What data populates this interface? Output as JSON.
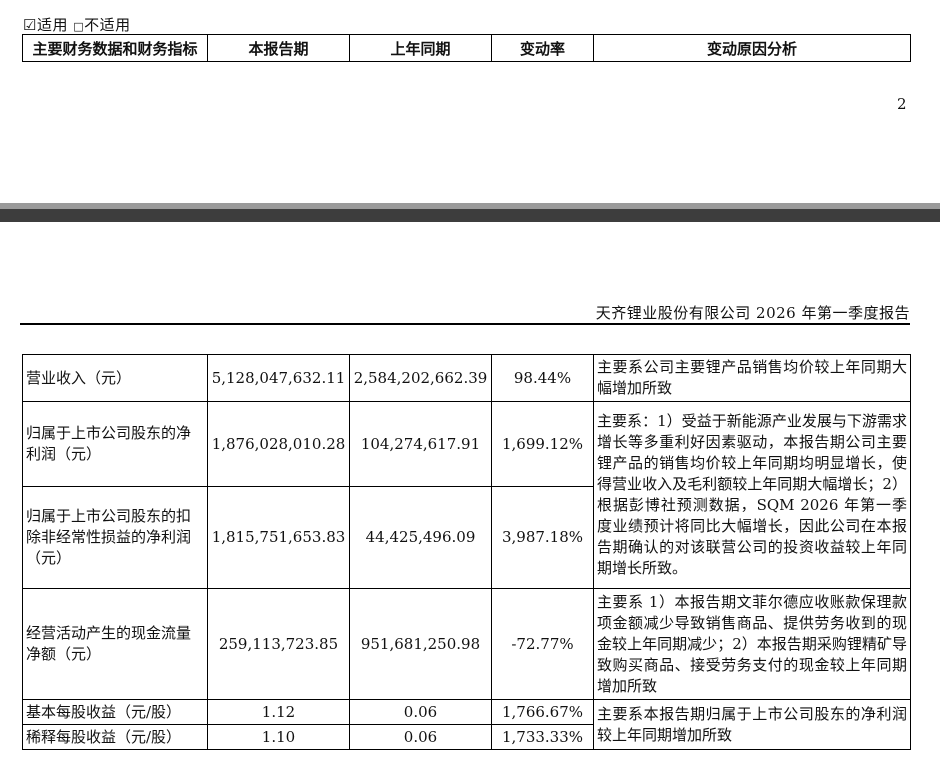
{
  "applicability": {
    "applicable_mark": "☑",
    "applicable_label": "适用",
    "not_applicable_mark": "□",
    "not_applicable_label": "不适用"
  },
  "header": {
    "col_indicator": "主要财务数据和财务指标",
    "col_current": "本报告期",
    "col_prior": "上年同期",
    "col_change": "变动率",
    "col_reason": "变动原因分析"
  },
  "page_number": "2",
  "report_title": "天齐锂业股份有限公司 2026 年第一季度报告",
  "rows": [
    {
      "label": "营业收入（元）",
      "current": "5,128,047,632.11",
      "prior": "2,584,202,662.39",
      "change": "98.44%",
      "reason": "主要系公司主要锂产品销售均价较上年同期大幅增加所致"
    },
    {
      "label": "归属于上市公司股东的净利润（元）",
      "current": "1,876,028,010.28",
      "prior": "104,274,617.91",
      "change": "1,699.12%",
      "reason": "主要系：1）受益于新能源产业发展与下游需求增长等多重利好因素驱动，本报告期公司主要锂产品的销售均价较上年同期均明显增长，使得营业收入及毛利额较上年同期大幅增长；2）根据彭博社预测数据，SQM 2026 年第一季度业绩预计将同比大幅增长，因此公司在本报告期确认的对该联营公司的投资收益较上年同期增长所致。"
    },
    {
      "label": "归属于上市公司股东的扣除非经常性损益的净利润（元）",
      "current": "1,815,751,653.83",
      "prior": "44,425,496.09",
      "change": "3,987.18%"
    },
    {
      "label": "经营活动产生的现金流量净额（元）",
      "current": "259,113,723.85",
      "prior": "951,681,250.98",
      "change": "-72.77%",
      "reason": "主要系 1）本报告期文菲尔德应收账款保理款项金额减少导致销售商品、提供劳务收到的现金较上年同期减少；2）本报告期采购锂精矿导致购买商品、接受劳务支付的现金较上年同期增加所致"
    },
    {
      "label": "基本每股收益（元/股）",
      "current": "1.12",
      "prior": "0.06",
      "change": "1,766.67%",
      "reason": "主要系本报告期归属于上市公司股东的净利润较上年同期增加所致"
    },
    {
      "label": "稀释每股收益（元/股）",
      "current": "1.10",
      "prior": "0.06",
      "change": "1,733.33%"
    }
  ]
}
